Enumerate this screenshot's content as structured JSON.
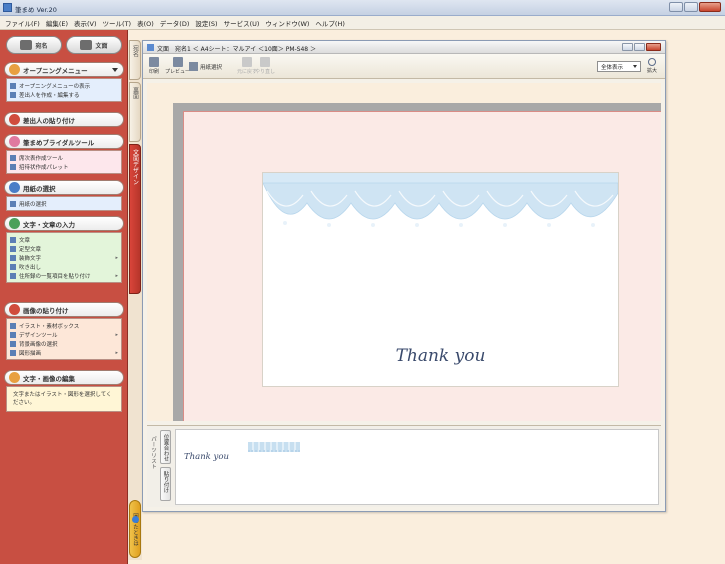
{
  "window": {
    "title": "筆まめ Ver.20"
  },
  "menu": [
    "ファイル(F)",
    "編集(E)",
    "表示(V)",
    "ツール(T)",
    "表(O)",
    "データ(D)",
    "設定(S)",
    "サービス(U)",
    "ウィンドウ(W)",
    "ヘルプ(H)"
  ],
  "left_panel": {
    "top_buttons": [
      "宛名",
      "文面"
    ],
    "sections": [
      {
        "title": "オープニングメニュー",
        "items": [
          "オープニングメニューの表示",
          "差出人を作成・編集する"
        ]
      },
      {
        "title": "差出人の貼り付け",
        "items": []
      },
      {
        "title": "筆まめブライダルツール",
        "items": [
          "席次表作成ツール",
          "招待状作成パレット"
        ]
      },
      {
        "title": "用紙の選択",
        "items": [
          "用紙の選択"
        ]
      },
      {
        "title": "文字・文章の入力",
        "items": [
          "文章",
          "定型文章",
          "装飾文字",
          "吹き出し",
          "住所録の一覧項目を貼り付け"
        ]
      },
      {
        "title": "画像の貼り付け",
        "items": [
          "イラスト・素材ボックス",
          "デザインツール",
          "背景画像の選択",
          "図形描画"
        ]
      },
      {
        "title": "文字・画像の編集",
        "items": []
      }
    ],
    "hint": "文字またはイラスト・図形を選択してください。"
  },
  "side_tabs": [
    "宛名",
    "裏面",
    "文面デザイン"
  ],
  "help_tab": "困ったときは",
  "document": {
    "title": "文面　宛名1 ＜ A4シート：マルアイ ＜10面＞ PM-S48 ＞",
    "toolbar": {
      "print_label": "印刷",
      "print_preview_label": "プレビュー",
      "paper_select_label": "用紙選択",
      "undo_label": "元に戻す",
      "redo_label": "やり直し",
      "view_option": "全体表示",
      "zoom_label": "拡大"
    },
    "card_text": "Thank you"
  },
  "parts_panel": {
    "label": "パーツリスト",
    "buttons": [
      "位置合わせ",
      "貼り付け"
    ],
    "part_text": "Thank you"
  }
}
